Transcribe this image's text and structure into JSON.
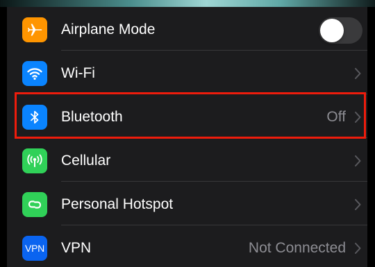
{
  "settings": {
    "rows": [
      {
        "label": "Airplane Mode",
        "icon": "airplane-icon",
        "icon_color": "#ff9500",
        "control": "toggle",
        "toggle_on": false
      },
      {
        "label": "Wi-Fi",
        "icon": "wifi-icon",
        "icon_color": "#0a84ff",
        "control": "chevron",
        "detail": ""
      },
      {
        "label": "Bluetooth",
        "icon": "bluetooth-icon",
        "icon_color": "#0a84ff",
        "control": "chevron",
        "detail": "Off",
        "highlighted": true
      },
      {
        "label": "Cellular",
        "icon": "cellular-antenna-icon",
        "icon_color": "#30d158",
        "control": "chevron",
        "detail": ""
      },
      {
        "label": "Personal Hotspot",
        "icon": "hotspot-link-icon",
        "icon_color": "#30d158",
        "control": "chevron",
        "detail": ""
      },
      {
        "label": "VPN",
        "icon": "vpn-icon",
        "icon_text": "VPN",
        "icon_color": "#0a64f0",
        "control": "chevron",
        "detail": "Not Connected"
      }
    ],
    "highlight_color": "#ee1c0c"
  }
}
